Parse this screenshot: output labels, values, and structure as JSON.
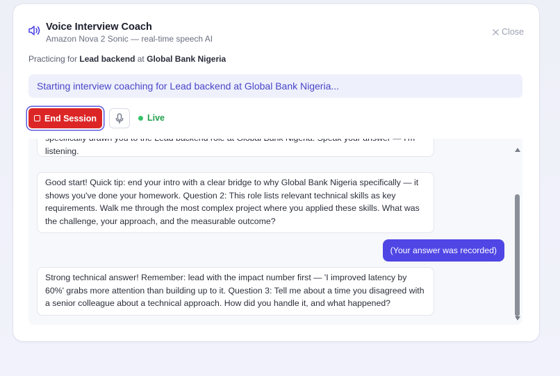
{
  "header": {
    "title": "Voice Interview Coach",
    "subtitle": "Amazon Nova 2 Sonic — real-time speech AI",
    "close_label": "Close"
  },
  "practicing": {
    "prefix": "Practicing for",
    "role": "Lead backend",
    "at": "at",
    "company": "Global Bank Nigeria"
  },
  "banner": {
    "text": "Starting interview coaching for Lead backend at Global Bank Nigeria..."
  },
  "controls": {
    "end_label": "End Session",
    "status_label": "Live"
  },
  "transcript": {
    "messages": [
      {
        "role": "coach",
        "line1": "specifically drawn you to the Lead backend role at Global Bank Nigeria. Speak your answer — I'm",
        "line2": "listening."
      },
      {
        "role": "coach",
        "text": "Good start! Quick tip: end your intro with a clear bridge to why Global Bank Nigeria specifically — it shows you've done your homework. Question 2: This role lists relevant technical skills as key requirements. Walk me through the most complex project where you applied these skills. What was the challenge, your approach, and the measurable outcome?"
      },
      {
        "role": "user",
        "text": "(Your answer was recorded)"
      },
      {
        "role": "coach",
        "text": "Strong technical answer! Remember: lead with the impact number first — 'I improved latency by 60%' grabs more attention than building up to it. Question 3: Tell me about a time you disagreed with a senior colleague about a technical approach. How did you handle it, and what happened?"
      }
    ]
  },
  "icons": {
    "speaker": "speaker-icon",
    "close": "close-icon",
    "stop": "stop-icon",
    "mic": "microphone-icon"
  },
  "colors": {
    "accent": "#4f46e5",
    "danger": "#dc2626",
    "live": "#22a04b"
  }
}
